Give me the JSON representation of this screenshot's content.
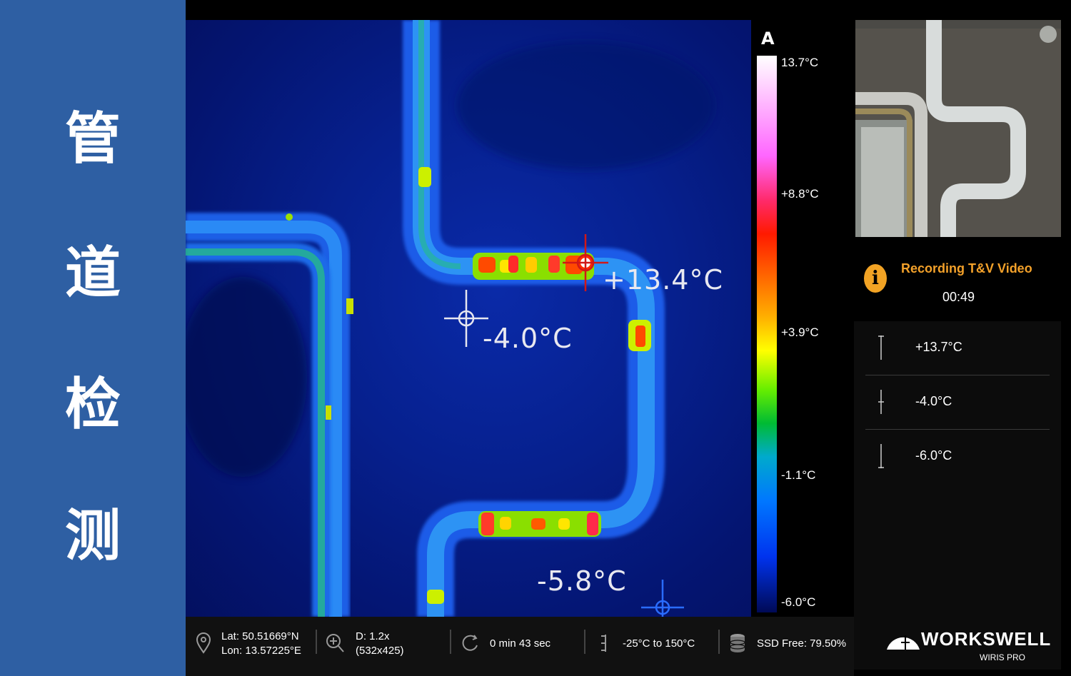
{
  "title_chars": [
    "管",
    "道",
    "检",
    "测"
  ],
  "colors": {
    "title_strip": "#2e5fa3",
    "recording_accent": "#f3a12a"
  },
  "thermal": {
    "spot_hot": "+13.4°C",
    "spot_center": "-4.0°C",
    "spot_cold": "-5.8°C"
  },
  "scale": {
    "mode": "A",
    "max": "13.7°C",
    "tick_1": "+8.8°C",
    "tick_2": "+3.9°C",
    "tick_3": "-1.1°C",
    "min": "-6.0°C"
  },
  "recording": {
    "icon": "info-icon",
    "title": "Recording T&V Video",
    "time": "00:49"
  },
  "readings": [
    {
      "icon": "max-marker-icon",
      "value": "+13.7°C"
    },
    {
      "icon": "center-marker-icon",
      "value": "-4.0°C"
    },
    {
      "icon": "min-marker-icon",
      "value": "-6.0°C"
    }
  ],
  "status": {
    "lat": "Lat: 50.51669°N",
    "lon": "Lon: 13.57225°E",
    "zoom": "D: 1.2x",
    "resolution": "(532x425)",
    "duration": "0 min 43 sec",
    "range": "-25°C to 150°C",
    "storage": "SSD Free: 79.50%"
  },
  "logo": {
    "main": "WORKSWELL",
    "sub": "WIRIS PRO"
  }
}
